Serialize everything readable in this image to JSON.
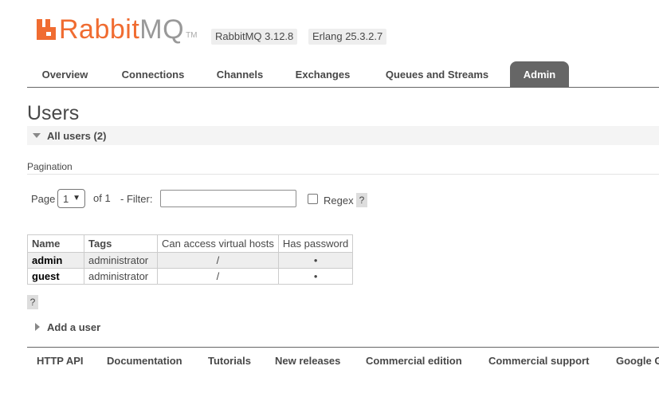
{
  "header": {
    "logo_rabbit": "Rabbit",
    "logo_mq": "MQ",
    "logo_tm": "TM",
    "version_badge": "RabbitMQ 3.12.8",
    "erlang_badge": "Erlang 25.3.2.7"
  },
  "tabs": [
    {
      "label": "Overview"
    },
    {
      "label": "Connections"
    },
    {
      "label": "Channels"
    },
    {
      "label": "Exchanges"
    },
    {
      "label": "Queues and Streams"
    },
    {
      "label": "Admin",
      "active": true
    }
  ],
  "main": {
    "title": "Users",
    "section_label": "All users (2)",
    "pagination_label": "Pagination",
    "page_label": "Page",
    "page_value": "1",
    "of_label": "of 1",
    "filter_label": "- Filter:",
    "filter_value": "",
    "regex_label": "Regex",
    "help_label": "?",
    "table": {
      "headers": [
        "Name",
        "Tags",
        "Can access virtual hosts",
        "Has password"
      ],
      "rows": [
        [
          "admin",
          "administrator",
          "/",
          "•"
        ],
        [
          "guest",
          "administrator",
          "/",
          "•"
        ]
      ]
    },
    "table_help": "?",
    "add_user_label": "Add a user"
  },
  "footer": {
    "links": [
      "HTTP API",
      "Documentation",
      "Tutorials",
      "New releases",
      "Commercial edition",
      "Commercial support",
      "Google Group"
    ]
  },
  "colors": {
    "brand_orange": "#f06c31",
    "tab_active_bg": "#666666",
    "row_alt_bg": "#eeeeee"
  }
}
